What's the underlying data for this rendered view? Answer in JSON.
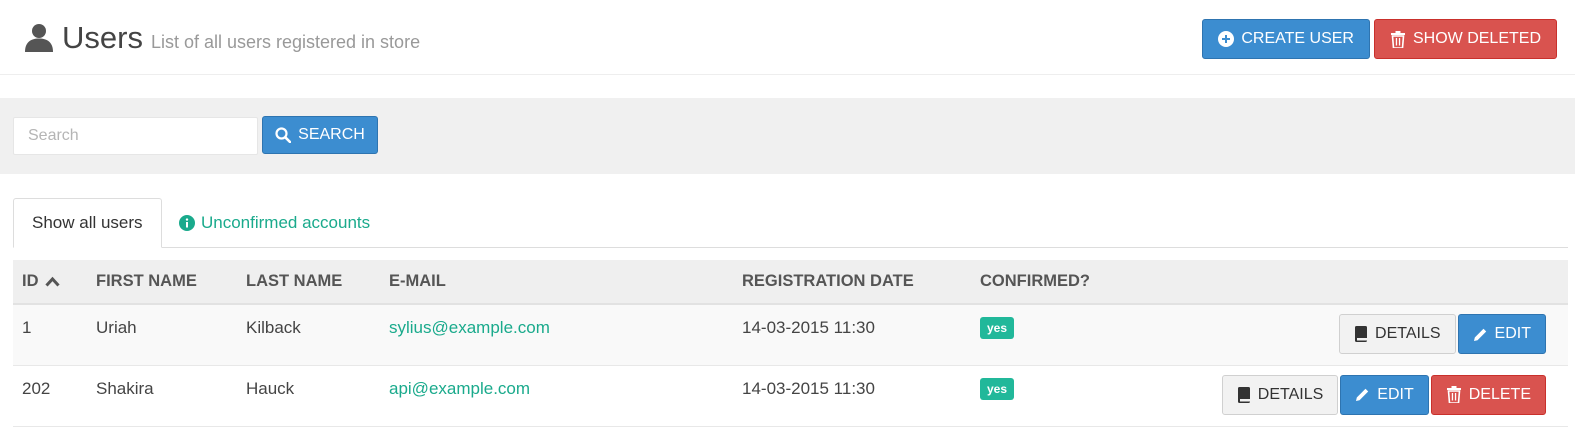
{
  "header": {
    "title": "Users",
    "subtitle": "List of all users registered in store",
    "title_icon": "user-icon",
    "create_label": "CREATE USER",
    "show_deleted_label": "SHOW DELETED"
  },
  "search": {
    "placeholder": "Search",
    "value": "",
    "button_label": "SEARCH"
  },
  "tabs": [
    {
      "label": "Show all users",
      "active": true
    },
    {
      "label": "Unconfirmed accounts",
      "icon": "info-circle-icon",
      "active": false
    }
  ],
  "table": {
    "columns": [
      "ID",
      "FIRST NAME",
      "LAST NAME",
      "E-MAIL",
      "REGISTRATION DATE",
      "CONFIRMED?"
    ],
    "sort_icon": "chevron-up-icon",
    "rows": [
      {
        "id": "1",
        "first_name": "Uriah",
        "last_name": "Kilback",
        "email": "sylius@example.com",
        "registered": "14-03-2015 11:30",
        "confirmed": "yes",
        "actions": [
          "DETAILS",
          "EDIT"
        ]
      },
      {
        "id": "202",
        "first_name": "Shakira",
        "last_name": "Hauck",
        "email": "api@example.com",
        "registered": "14-03-2015 11:30",
        "confirmed": "yes",
        "actions": [
          "DETAILS",
          "EDIT",
          "DELETE"
        ]
      }
    ]
  },
  "colors": {
    "primary": "#3c8dd0",
    "danger": "#d9534f",
    "link": "#1aaa8c",
    "badge": "#21b89a"
  }
}
